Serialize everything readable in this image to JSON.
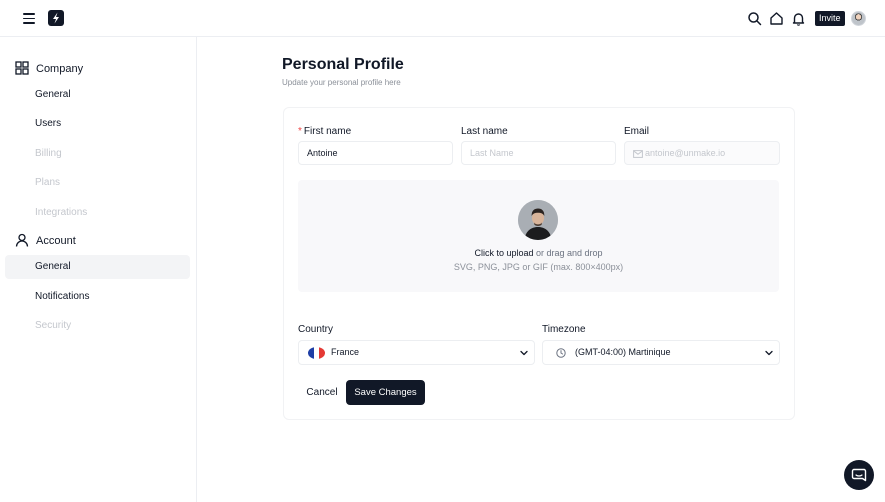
{
  "topbar": {
    "invite_label": "Invite"
  },
  "sidebar": {
    "groups": [
      {
        "label": "Company",
        "icon": "grid-icon",
        "items": [
          {
            "label": "General",
            "state": "normal"
          },
          {
            "label": "Users",
            "state": "normal"
          },
          {
            "label": "Billing",
            "state": "disabled"
          },
          {
            "label": "Plans",
            "state": "disabled"
          },
          {
            "label": "Integrations",
            "state": "disabled"
          }
        ]
      },
      {
        "label": "Account",
        "icon": "user-icon",
        "items": [
          {
            "label": "General",
            "state": "active"
          },
          {
            "label": "Notifications",
            "state": "normal"
          },
          {
            "label": "Security",
            "state": "disabled"
          }
        ]
      }
    ]
  },
  "page": {
    "title": "Personal Profile",
    "subtitle": "Update your personal profile here"
  },
  "form": {
    "first_name": {
      "label": "First name",
      "required_mark": "*",
      "value": "Antoine"
    },
    "last_name": {
      "label": "Last name",
      "placeholder": "Last Name"
    },
    "email": {
      "label": "Email",
      "placeholder": "antoine@unmake.io"
    },
    "upload": {
      "action": "Click to upload",
      "hint_rest": " or drag and drop",
      "formats": "SVG, PNG, JPG or GIF (max. 800×400px)"
    },
    "country": {
      "label": "Country",
      "value": "France",
      "flag_colors": [
        "#1f3fa6",
        "#ffffff",
        "#e53935"
      ]
    },
    "timezone": {
      "label": "Timezone",
      "value": "(GMT-04:00) Martinique"
    },
    "cancel_label": "Cancel",
    "save_label": "Save Changes"
  },
  "colors": {
    "primary": "#111827",
    "required": "#ef4444",
    "muted": "#8b9099",
    "disabled": "#c4c7cd"
  }
}
